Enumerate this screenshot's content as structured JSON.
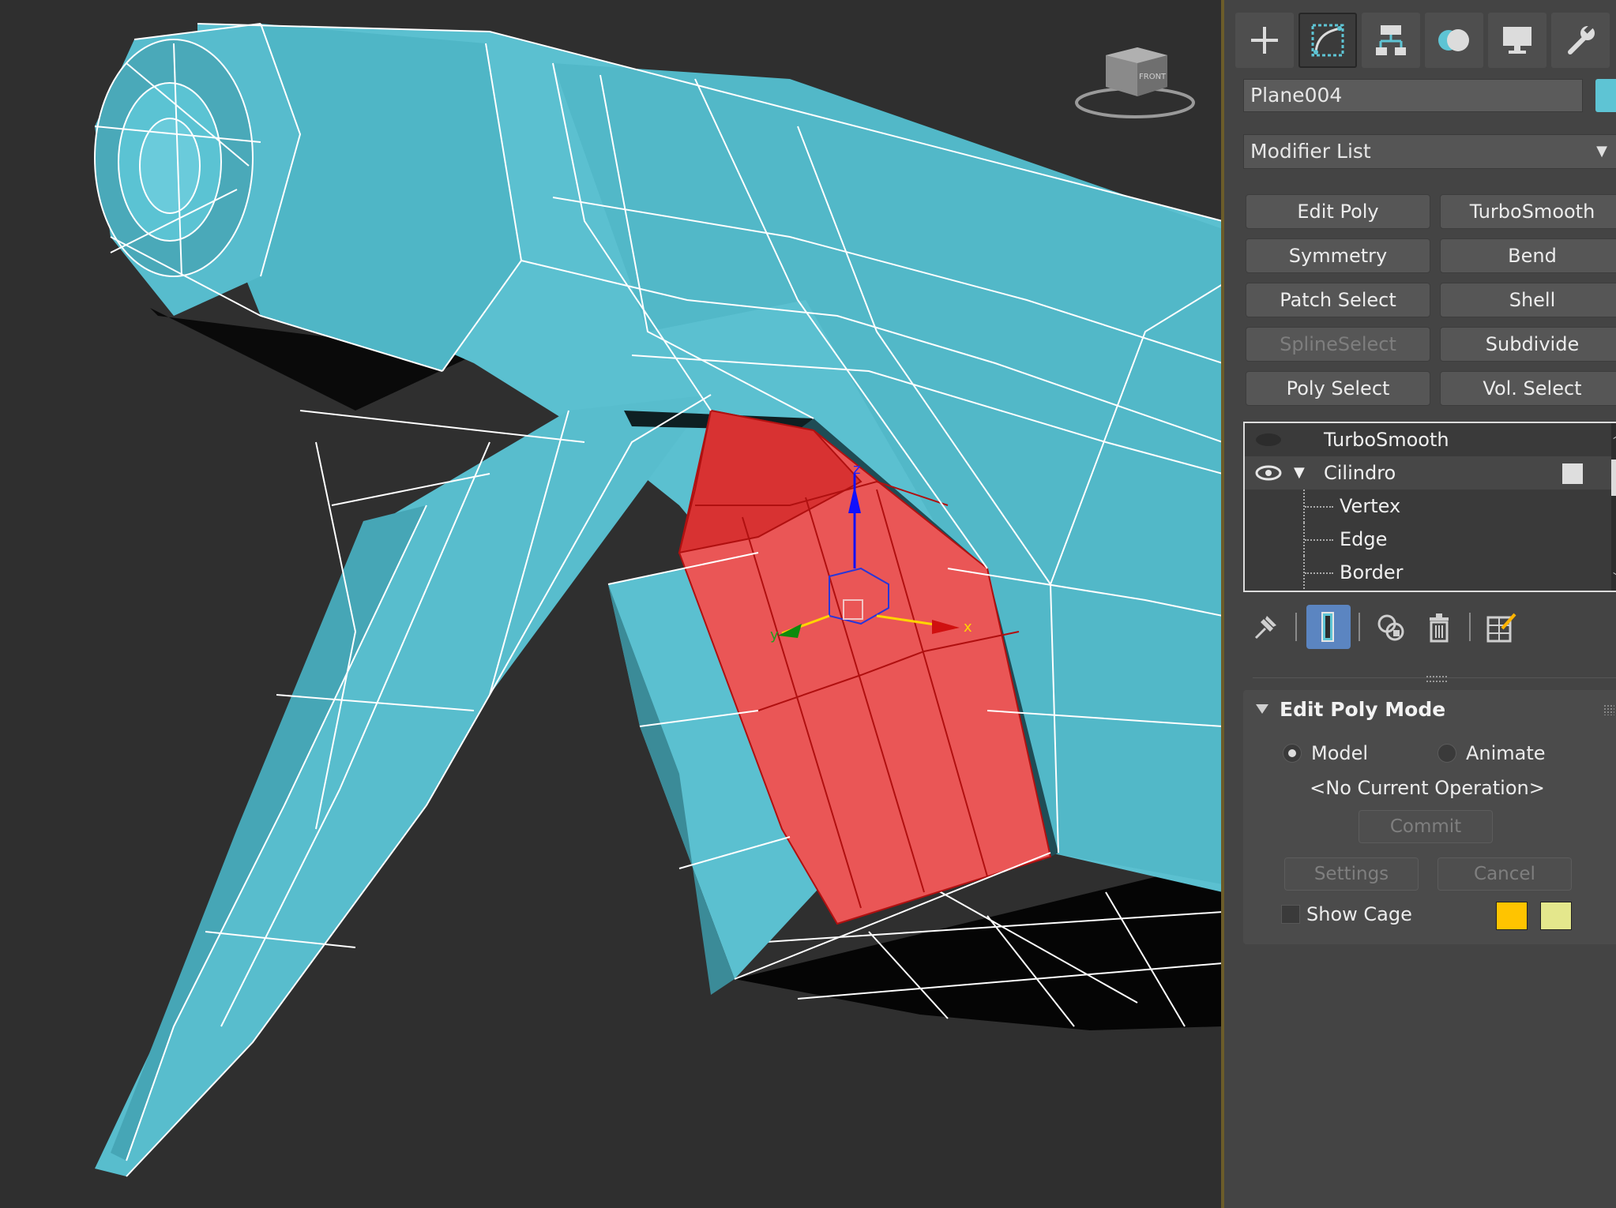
{
  "viewport": {
    "viewcube_label": "FRONT",
    "colors": {
      "mesh": "#5ec4d4",
      "selection": "#e84e50",
      "background": "#2f2f2f"
    },
    "gizmo_axes": [
      "x",
      "y",
      "z"
    ]
  },
  "panel": {
    "tabs": [
      {
        "name": "create",
        "icon": "plus-icon"
      },
      {
        "name": "modify",
        "icon": "modify-curve-icon",
        "active": true
      },
      {
        "name": "hierarchy",
        "icon": "hierarchy-icon"
      },
      {
        "name": "motion",
        "icon": "motion-icon"
      },
      {
        "name": "display",
        "icon": "display-monitor-icon"
      },
      {
        "name": "utilities",
        "icon": "wrench-icon"
      }
    ],
    "object_name": "Plane004",
    "object_color": "#5ec4d4",
    "modifier_list_label": "Modifier List",
    "modifier_buttons": [
      {
        "label": "Edit Poly"
      },
      {
        "label": "TurboSmooth"
      },
      {
        "label": "Symmetry"
      },
      {
        "label": "Bend"
      },
      {
        "label": "Patch Select"
      },
      {
        "label": "Shell"
      },
      {
        "label": "SplineSelect",
        "disabled": true
      },
      {
        "label": "Subdivide"
      },
      {
        "label": "Poly Select"
      },
      {
        "label": "Vol. Select"
      }
    ],
    "stack": [
      {
        "label": "TurboSmooth"
      },
      {
        "label": "Cilindro"
      },
      {
        "label": "Vertex"
      },
      {
        "label": "Edge"
      },
      {
        "label": "Border"
      }
    ],
    "rollout": {
      "title": "Edit Poly Mode",
      "model_label": "Model",
      "animate_label": "Animate",
      "selected_mode": "Model",
      "operation_text": "<No Current Operation>",
      "commit_label": "Commit",
      "settings_label": "Settings",
      "cancel_label": "Cancel",
      "show_cage_label": "Show Cage",
      "cage_color_1": "#ffc400",
      "cage_color_2": "#e4e78c"
    }
  }
}
